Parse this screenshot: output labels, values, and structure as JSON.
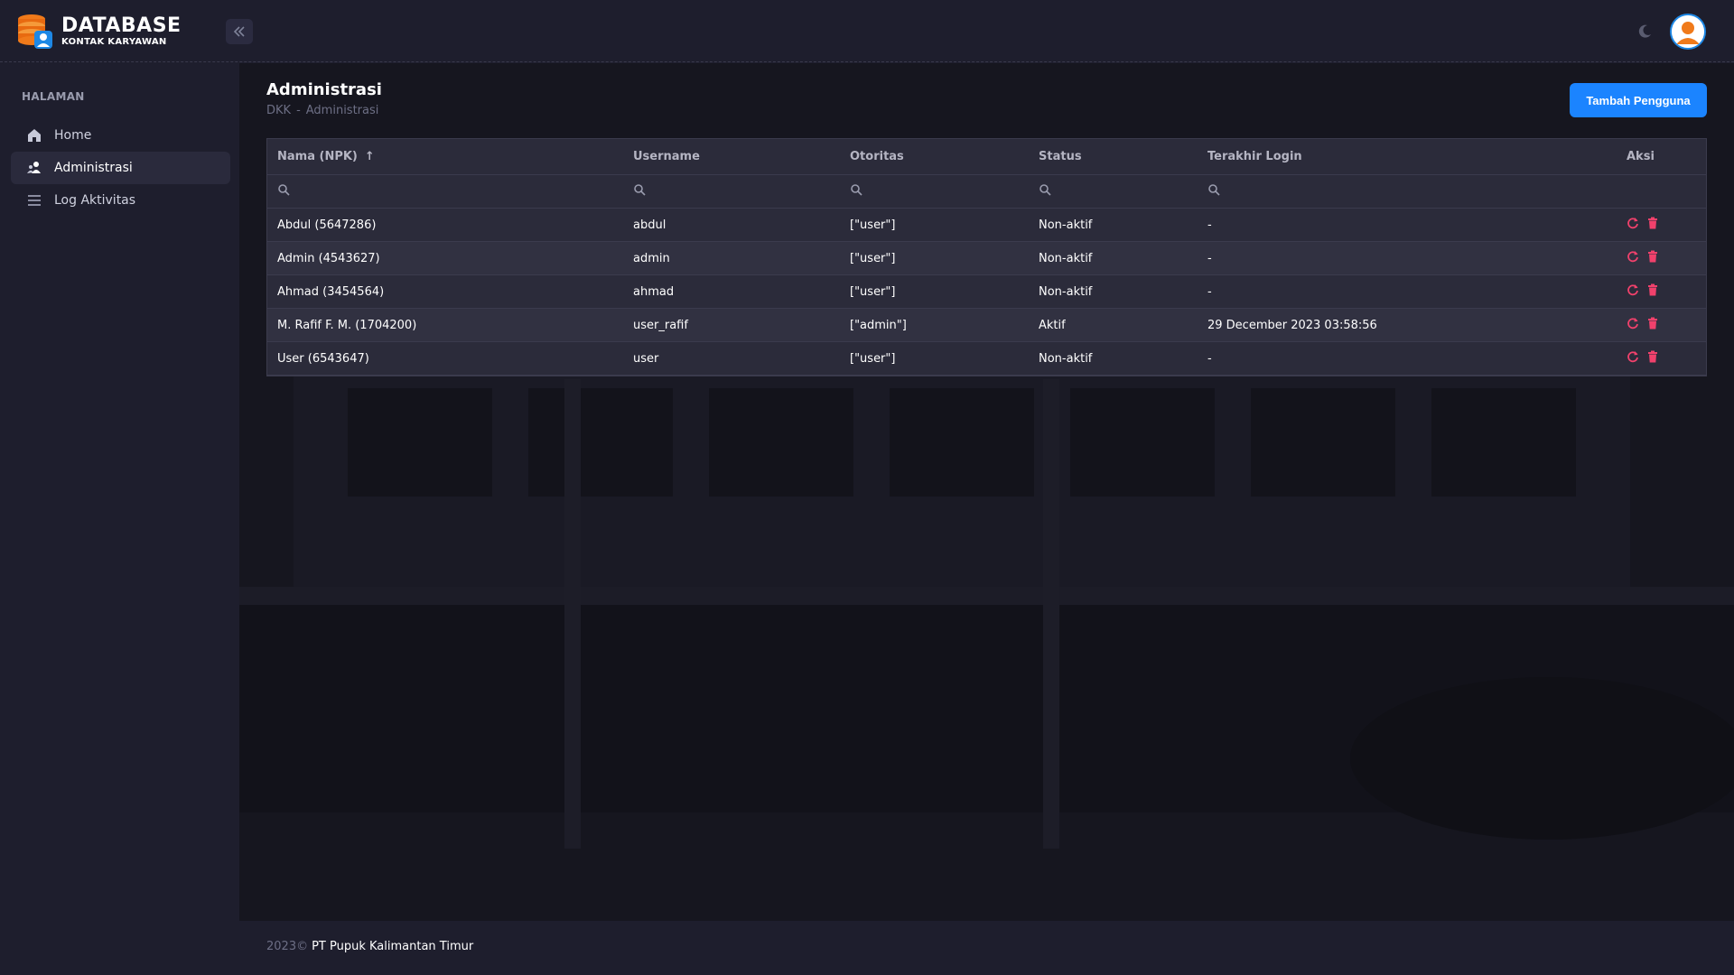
{
  "brand": {
    "title": "DATABASE",
    "subtitle": "KONTAK KARYAWAN",
    "logo_icon": "database-user-icon"
  },
  "header": {
    "collapse_icon": "double-chevron-left-icon",
    "theme_icon": "moon-icon",
    "avatar_icon": "user-avatar-icon"
  },
  "sidebar": {
    "section": "HALAMAN",
    "items": [
      {
        "label": "Home",
        "icon": "home-icon",
        "active": false
      },
      {
        "label": "Administrasi",
        "icon": "users-icon",
        "active": true
      },
      {
        "label": "Log Aktivitas",
        "icon": "list-icon",
        "active": false
      }
    ]
  },
  "page": {
    "title": "Administrasi",
    "breadcrumb": [
      "DKK",
      "-",
      "Administrasi"
    ],
    "add_button": "Tambah Pengguna"
  },
  "table": {
    "columns": [
      "Nama (NPK)",
      "Username",
      "Otoritas",
      "Status",
      "Terakhir Login",
      "Aksi"
    ],
    "sort_indicator": "↑",
    "rows": [
      [
        "Abdul (5647286)",
        "abdul",
        "[\"user\"]",
        "Non-aktif",
        "-"
      ],
      [
        "Admin (4543627)",
        "admin",
        "[\"user\"]",
        "Non-aktif",
        "-"
      ],
      [
        "Ahmad (3454564)",
        "ahmad",
        "[\"user\"]",
        "Non-aktif",
        "-"
      ],
      [
        "M. Rafif F. M. (1704200)",
        "user_rafif",
        "[\"admin\"]",
        "Aktif",
        "29 December 2023 03:58:56"
      ],
      [
        "User (6543647)",
        "user",
        "[\"user\"]",
        "Non-aktif",
        "-"
      ]
    ],
    "action_icons": [
      "refresh-icon",
      "trash-icon"
    ],
    "action_color": "#f1416c"
  },
  "footer": {
    "year": "2023©",
    "company": "PT Pupuk Kalimantan Timur"
  },
  "colors": {
    "accent": "#1b84ff",
    "background": "#1e1e2d",
    "danger": "#f1416c"
  }
}
